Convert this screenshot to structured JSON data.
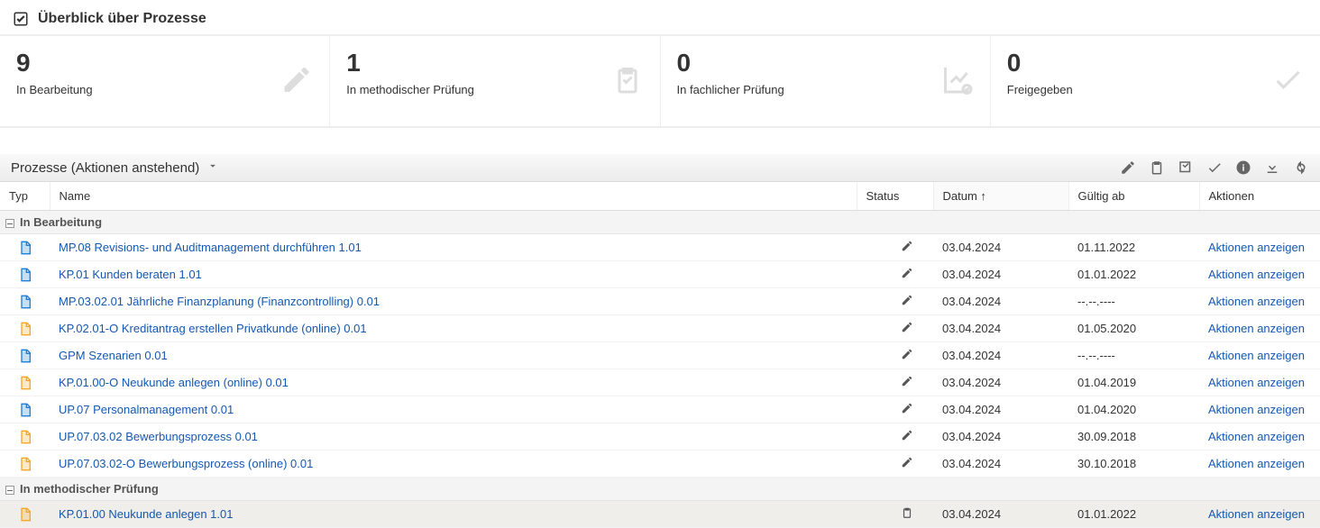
{
  "header": {
    "title": "Überblick über Prozesse"
  },
  "metrics": [
    {
      "value": "9",
      "label": "In Bearbeitung",
      "icon": "pencil"
    },
    {
      "value": "1",
      "label": "In methodischer Prüfung",
      "icon": "clipboard"
    },
    {
      "value": "0",
      "label": "In fachlicher Prüfung",
      "icon": "chart"
    },
    {
      "value": "0",
      "label": "Freigegeben",
      "icon": "check"
    }
  ],
  "toolbar": {
    "title": "Prozesse (Aktionen anstehend)"
  },
  "columns": {
    "typ": "Typ",
    "name": "Name",
    "status": "Status",
    "date": "Datum",
    "sort": "↑",
    "valid": "Gültig ab",
    "actions": "Aktionen"
  },
  "groups": [
    {
      "label": "In Bearbeitung",
      "rows": [
        {
          "icon": "blue",
          "name": "MP.08 Revisions- und Auditmanagement durchführen 1.01",
          "status": "pencil",
          "date": "03.04.2024",
          "valid": "01.11.2022",
          "action": "Aktionen anzeigen"
        },
        {
          "icon": "blue",
          "name": "KP.01 Kunden beraten 1.01",
          "status": "pencil",
          "date": "03.04.2024",
          "valid": "01.01.2022",
          "action": "Aktionen anzeigen"
        },
        {
          "icon": "blue",
          "name": "MP.03.02.01 Jährliche Finanzplanung (Finanzcontrolling) 0.01",
          "status": "pencil",
          "date": "03.04.2024",
          "valid": "--.--.----",
          "action": "Aktionen anzeigen"
        },
        {
          "icon": "orange",
          "name": "KP.02.01-O Kreditantrag erstellen Privatkunde (online) 0.01",
          "status": "pencil",
          "date": "03.04.2024",
          "valid": "01.05.2020",
          "action": "Aktionen anzeigen"
        },
        {
          "icon": "blue",
          "name": "GPM Szenarien 0.01",
          "status": "pencil",
          "date": "03.04.2024",
          "valid": "--.--.----",
          "action": "Aktionen anzeigen"
        },
        {
          "icon": "orange",
          "name": "KP.01.00-O Neukunde anlegen (online) 0.01",
          "status": "pencil",
          "date": "03.04.2024",
          "valid": "01.04.2019",
          "action": "Aktionen anzeigen"
        },
        {
          "icon": "blue",
          "name": "UP.07 Personalmanagement 0.01",
          "status": "pencil",
          "date": "03.04.2024",
          "valid": "01.04.2020",
          "action": "Aktionen anzeigen"
        },
        {
          "icon": "orange",
          "name": "UP.07.03.02 Bewerbungsprozess 0.01",
          "status": "pencil",
          "date": "03.04.2024",
          "valid": "30.09.2018",
          "action": "Aktionen anzeigen"
        },
        {
          "icon": "orange",
          "name": "UP.07.03.02-O Bewerbungsprozess (online) 0.01",
          "status": "pencil",
          "date": "03.04.2024",
          "valid": "30.10.2018",
          "action": "Aktionen anzeigen"
        }
      ]
    },
    {
      "label": "In methodischer Prüfung",
      "rows": [
        {
          "icon": "orange",
          "selected": true,
          "name": "KP.01.00 Neukunde anlegen 1.01",
          "status": "clipboard",
          "date": "03.04.2024",
          "valid": "01.01.2022",
          "action": "Aktionen anzeigen"
        }
      ]
    }
  ]
}
